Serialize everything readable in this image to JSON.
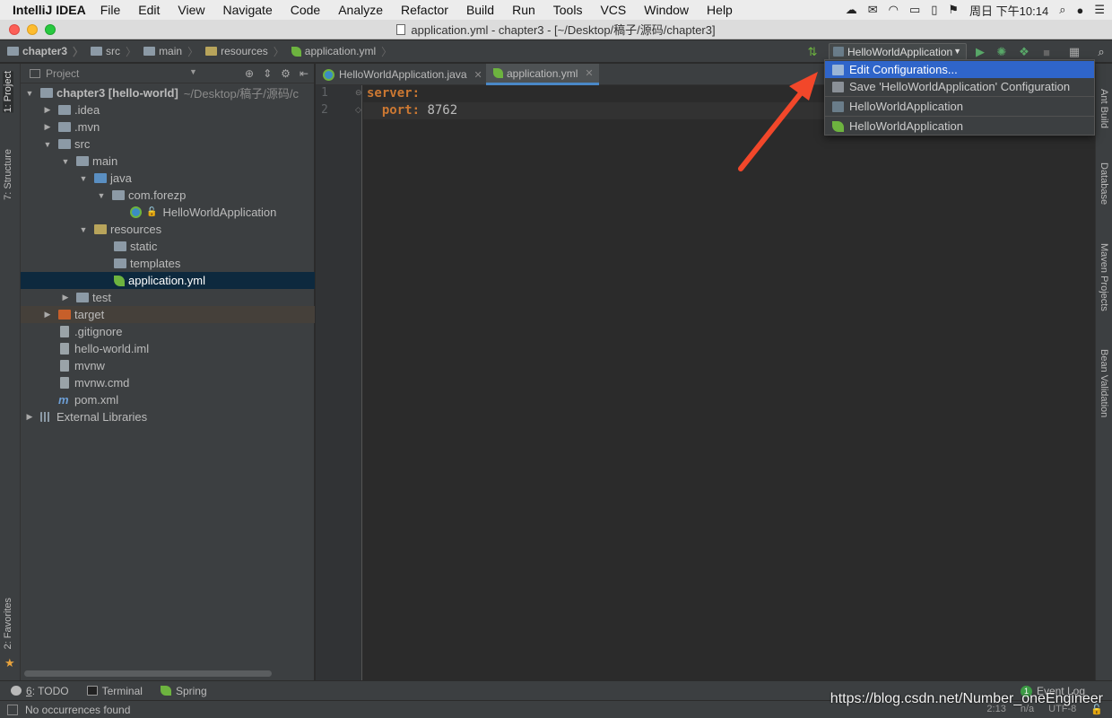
{
  "menubar": {
    "app": "IntelliJ IDEA",
    "items": [
      "File",
      "Edit",
      "View",
      "Navigate",
      "Code",
      "Analyze",
      "Refactor",
      "Build",
      "Run",
      "Tools",
      "VCS",
      "Window",
      "Help"
    ],
    "clock": "周日 下午10:14"
  },
  "window": {
    "title": "application.yml - chapter3 - [~/Desktop/稿子/源码/chapter3]"
  },
  "breadcrumb": [
    "chapter3",
    "src",
    "main",
    "resources",
    "application.yml"
  ],
  "run_config": {
    "selected": "HelloWorldApplication"
  },
  "dropdown": {
    "items": [
      "Edit Configurations...",
      "Save 'HelloWorldApplication' Configuration",
      "HelloWorldApplication",
      "HelloWorldApplication"
    ]
  },
  "project": {
    "header": "Project",
    "tree": [
      {
        "label": "chapter3 [hello-world]",
        "suffix": "~/Desktop/稿子/源码/c"
      },
      {
        "label": ".idea"
      },
      {
        "label": ".mvn"
      },
      {
        "label": "src"
      },
      {
        "label": "main"
      },
      {
        "label": "java"
      },
      {
        "label": "com.forezp"
      },
      {
        "label": "HelloWorldApplication"
      },
      {
        "label": "resources"
      },
      {
        "label": "static"
      },
      {
        "label": "templates"
      },
      {
        "label": "application.yml"
      },
      {
        "label": "test"
      },
      {
        "label": "target"
      },
      {
        "label": ".gitignore"
      },
      {
        "label": "hello-world.iml"
      },
      {
        "label": "mvnw"
      },
      {
        "label": "mvnw.cmd"
      },
      {
        "label": "pom.xml"
      },
      {
        "label": "External Libraries"
      }
    ]
  },
  "left_stripe": {
    "project": "1: Project",
    "structure": "7: Structure",
    "favorites": "2: Favorites"
  },
  "right_stripe": {
    "ant": "Ant Build",
    "database": "Database",
    "maven": "Maven Projects",
    "bean": "Bean Validation"
  },
  "editor": {
    "tabs": [
      "HelloWorldApplication.java",
      "application.yml"
    ],
    "lines": [
      {
        "num": "1",
        "key": "server:",
        "value": ""
      },
      {
        "num": "2",
        "key": "  port:",
        "value": " 8762"
      }
    ]
  },
  "toolwindows": {
    "todo_num": "6",
    "todo": ": TODO",
    "terminal": "Terminal",
    "spring": "Spring",
    "event_log": "Event Log",
    "event_count": "1"
  },
  "status": {
    "message": "No occurrences found",
    "position": "2:13",
    "sep": "n/a",
    "encoding": "UTF-8"
  },
  "watermark": "https://blog.csdn.net/Number_oneEngineer",
  "colors": {
    "accent": "#2f65ca",
    "yaml_key": "#cc7832",
    "annotation_arrow": "#f2472a"
  }
}
